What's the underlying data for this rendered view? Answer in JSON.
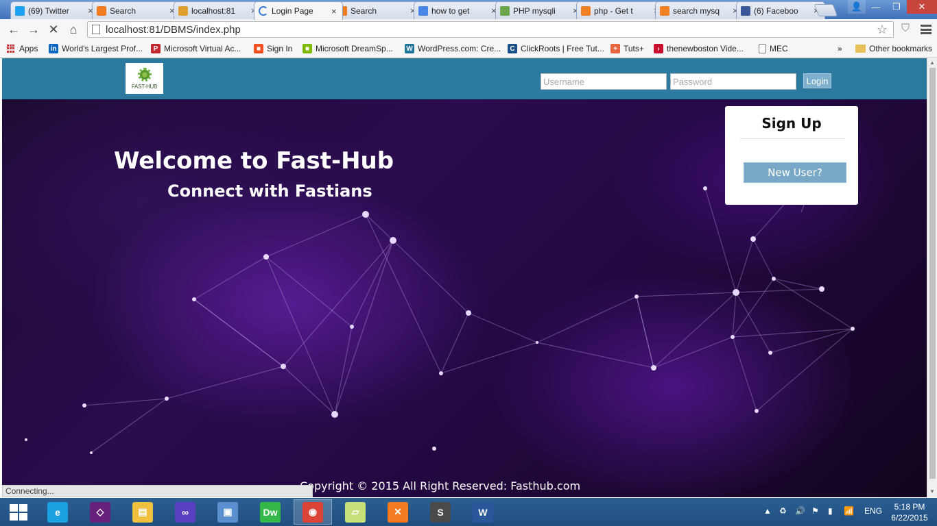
{
  "browser": {
    "tabs": [
      {
        "title": "(69) Twitter",
        "icon": "twitter-icon",
        "color": "#1da1f2"
      },
      {
        "title": "Search",
        "icon": "xampp-icon",
        "color": "#f57b20"
      },
      {
        "title": "localhost:81",
        "icon": "phpmyadmin-icon",
        "color": "#e0a030"
      },
      {
        "title": "Login Page",
        "icon": "loading-icon",
        "color": "#3a7bd5",
        "active": true
      },
      {
        "title": "Search",
        "icon": "xampp-icon",
        "color": "#f57b20"
      },
      {
        "title": "how to get",
        "icon": "google-icon",
        "color": "#4a86e8"
      },
      {
        "title": "PHP mysqli",
        "icon": "w3schools-icon",
        "color": "#6aa84f"
      },
      {
        "title": "php - Get t",
        "icon": "stackoverflow-icon",
        "color": "#f48024"
      },
      {
        "title": "search mysq",
        "icon": "stackoverflow-icon",
        "color": "#f48024"
      },
      {
        "title": "(6) Faceboo",
        "icon": "facebook-icon",
        "color": "#3b5998"
      }
    ],
    "url": "localhost:81/DBMS/index.php",
    "status_text": "Connecting..."
  },
  "bookmarks": {
    "apps_label": "Apps",
    "items": [
      {
        "label": "World's Largest Prof...",
        "icon": "linkedin-icon",
        "color": "#0a66c2",
        "glyph": "in"
      },
      {
        "label": "Microsoft Virtual Ac...",
        "icon": "mva-icon",
        "color": "#c4262e",
        "glyph": "P"
      },
      {
        "label": "Sign In",
        "icon": "microsoft-icon",
        "color": "#f25022",
        "glyph": "■"
      },
      {
        "label": "Microsoft DreamSp...",
        "icon": "microsoft-icon",
        "color": "#7fba00",
        "glyph": "■"
      },
      {
        "label": "WordPress.com: Cre...",
        "icon": "wordpress-icon",
        "color": "#21759b",
        "glyph": "W"
      },
      {
        "label": "ClickRoots | Free Tut...",
        "icon": "clickroots-icon",
        "color": "#1b4f8a",
        "glyph": "C"
      },
      {
        "label": "Tuts+",
        "icon": "tutsplus-icon",
        "color": "#e8663d",
        "glyph": "+"
      },
      {
        "label": "thenewboston Vide...",
        "icon": "thenewboston-icon",
        "color": "#c8102e",
        "glyph": "›"
      },
      {
        "label": "MEC",
        "icon": "page-icon",
        "color": "#ffffff",
        "glyph": ""
      }
    ],
    "overflow": "»",
    "other_label": "Other bookmarks"
  },
  "site": {
    "logo_text": "FAST-HUB",
    "username_placeholder": "Username",
    "password_placeholder": "Password",
    "login_label": "Login",
    "welcome": "Welcome to Fast-Hub",
    "tagline": "Connect with Fastians",
    "signup_title": "Sign Up",
    "new_user_label": "New User?",
    "copyright": "Copyright © 2015 All Right Reserved: Fasthub.com",
    "header_color": "#2c7aa0"
  },
  "taskbar": {
    "apps": [
      {
        "name": "internet-explorer-icon",
        "glyph": "e",
        "color": "#1ba1e2"
      },
      {
        "name": "visual-studio-icon",
        "glyph": "◇",
        "color": "#68217a"
      },
      {
        "name": "file-explorer-icon",
        "glyph": "▤",
        "color": "#f0c040"
      },
      {
        "name": "infinity-app-icon",
        "glyph": "∞",
        "color": "#5a3fc0"
      },
      {
        "name": "virtualbox-icon",
        "glyph": "▣",
        "color": "#5a8fd0"
      },
      {
        "name": "dreamweaver-icon",
        "glyph": "Dw",
        "color": "#35b84a"
      },
      {
        "name": "chrome-icon",
        "glyph": "◉",
        "color": "#db4437"
      },
      {
        "name": "sticky-notes-icon",
        "glyph": "▱",
        "color": "#c8e07a"
      },
      {
        "name": "xampp-icon",
        "glyph": "✕",
        "color": "#f57b20"
      },
      {
        "name": "sublime-text-icon",
        "glyph": "S",
        "color": "#4a4a4a"
      },
      {
        "name": "word-icon",
        "glyph": "W",
        "color": "#2b579a"
      }
    ],
    "language": "ENG",
    "time": "5:18 PM",
    "date": "6/22/2015"
  }
}
